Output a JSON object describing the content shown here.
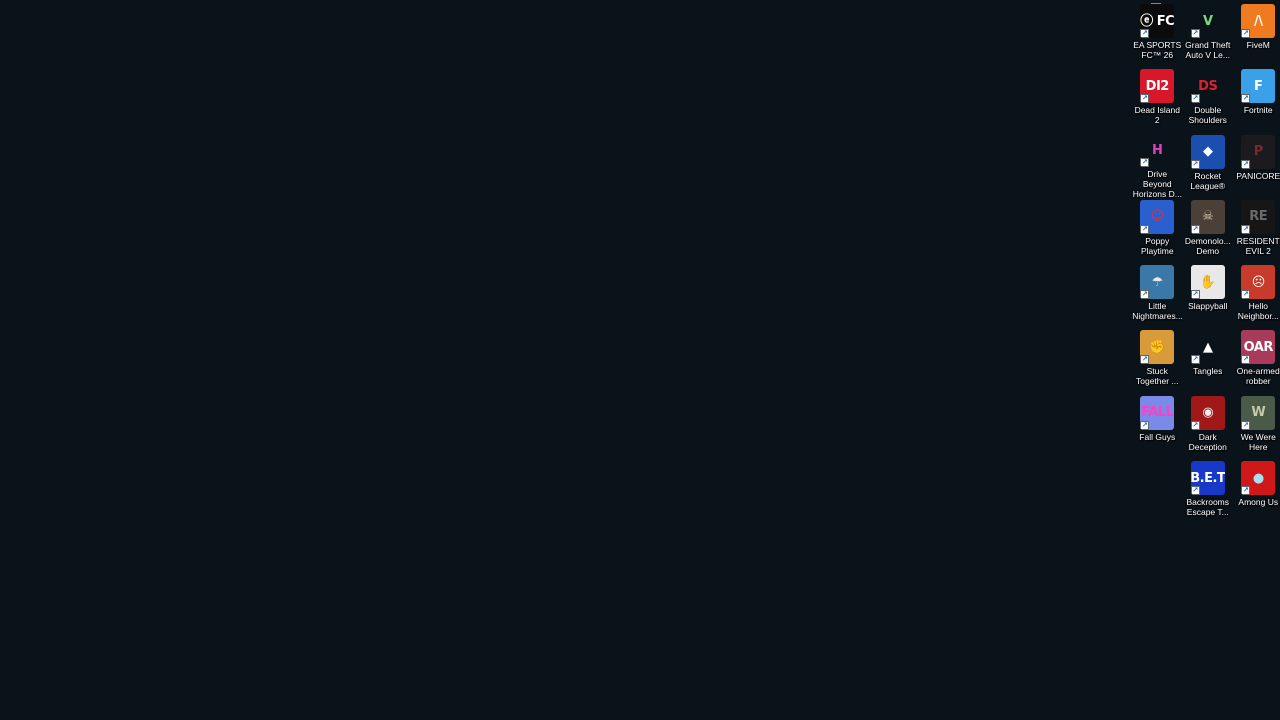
{
  "desktop": {
    "background_color": "#0a121a",
    "icons": [
      {
        "label": "EA SPORTS\nFC™ 26",
        "icon": "ea-sports-fc-icon",
        "glyph": "ⓔ FC",
        "bg": "#0b0b0b",
        "fg": "#ffffff"
      },
      {
        "label": "Grand Theft\nAuto V Le...",
        "icon": "gta-v-icon",
        "glyph": "V",
        "bg": "#0a121a",
        "fg": "#7fd97f"
      },
      {
        "label": "FiveM",
        "icon": "fivem-icon",
        "glyph": "/\\",
        "bg": "#f07a1f",
        "fg": "#ffffff"
      },
      {
        "label": "Dead Island 2",
        "icon": "dead-island-2-icon",
        "glyph": "DI2",
        "bg": "#d8182a",
        "fg": "#ffffff"
      },
      {
        "label": "Double\nShoulders",
        "icon": "double-shoulders-icon",
        "glyph": "DS",
        "bg": "#0a121a",
        "fg": "#e0202a"
      },
      {
        "label": "Fortnite",
        "icon": "fortnite-icon",
        "glyph": "F",
        "bg": "#3aa0e8",
        "fg": "#ffffff"
      },
      {
        "label": "Drive Beyond\nHorizons D...",
        "icon": "drive-beyond-horizons-icon",
        "glyph": "H",
        "bg": "#0a121a",
        "fg": "#e040c0"
      },
      {
        "label": "Rocket\nLeague®",
        "icon": "rocket-league-icon",
        "glyph": "◆",
        "bg": "#1a4fb0",
        "fg": "#ffffff"
      },
      {
        "label": "PANICORE",
        "icon": "panicore-icon",
        "glyph": "P",
        "bg": "#1a1a1f",
        "fg": "#7a2a2a"
      },
      {
        "label": "Poppy\nPlaytime",
        "icon": "poppy-playtime-icon",
        "glyph": "☺",
        "bg": "#2a5fd0",
        "fg": "#e03040"
      },
      {
        "label": "Demonolo...\nDemo",
        "icon": "demonologist-icon",
        "glyph": "☠",
        "bg": "#4a4038",
        "fg": "#d8c8b0"
      },
      {
        "label": "RESIDENT\nEVIL 2",
        "icon": "resident-evil-2-icon",
        "glyph": "RE",
        "bg": "#161616",
        "fg": "#6a6a6a"
      },
      {
        "label": "Little\nNightmares...",
        "icon": "little-nightmares-icon",
        "glyph": "☂",
        "bg": "#3a78a8",
        "fg": "#e8e8e8"
      },
      {
        "label": "Slappyball",
        "icon": "slappyball-icon",
        "glyph": "✋",
        "bg": "#e8e8e8",
        "fg": "#d02020"
      },
      {
        "label": "Hello\nNeighbor...",
        "icon": "hello-neighbor-icon",
        "glyph": "☹",
        "bg": "#c83a2a",
        "fg": "#ffffff"
      },
      {
        "label": "Stuck\nTogether ...",
        "icon": "stuck-together-icon",
        "glyph": "✊",
        "bg": "#d89a3a",
        "fg": "#5a3010"
      },
      {
        "label": "Tangles",
        "icon": "tangles-icon",
        "glyph": "▲",
        "bg": "#0a121a",
        "fg": "#ffffff"
      },
      {
        "label": "One-armed\nrobber",
        "icon": "one-armed-robber-icon",
        "glyph": "OAR",
        "bg": "#a83a5a",
        "fg": "#ffffff"
      },
      {
        "label": "Fall Guys",
        "icon": "fall-guys-icon",
        "glyph": "FALL",
        "bg": "#7a8ae8",
        "fg": "#ff40c0"
      },
      {
        "label": "Dark\nDeception",
        "icon": "dark-deception-icon",
        "glyph": "◉",
        "bg": "#a01818",
        "fg": "#f0f0f0"
      },
      {
        "label": "We Were\nHere",
        "icon": "we-were-here-icon",
        "glyph": "W",
        "bg": "#4a5a48",
        "fg": "#c8c8a8"
      },
      {
        "label": "",
        "icon": "empty-slot",
        "glyph": "",
        "bg": "transparent",
        "fg": "transparent",
        "empty": true
      },
      {
        "label": "Backrooms\nEscape T...",
        "icon": "backrooms-escape-together-icon",
        "glyph": "B.E.T",
        "bg": "#1838c8",
        "fg": "#ffffff"
      },
      {
        "label": "Among Us",
        "icon": "among-us-icon",
        "glyph": "●",
        "bg": "#d01818",
        "fg": "#a8e0f0"
      }
    ]
  }
}
